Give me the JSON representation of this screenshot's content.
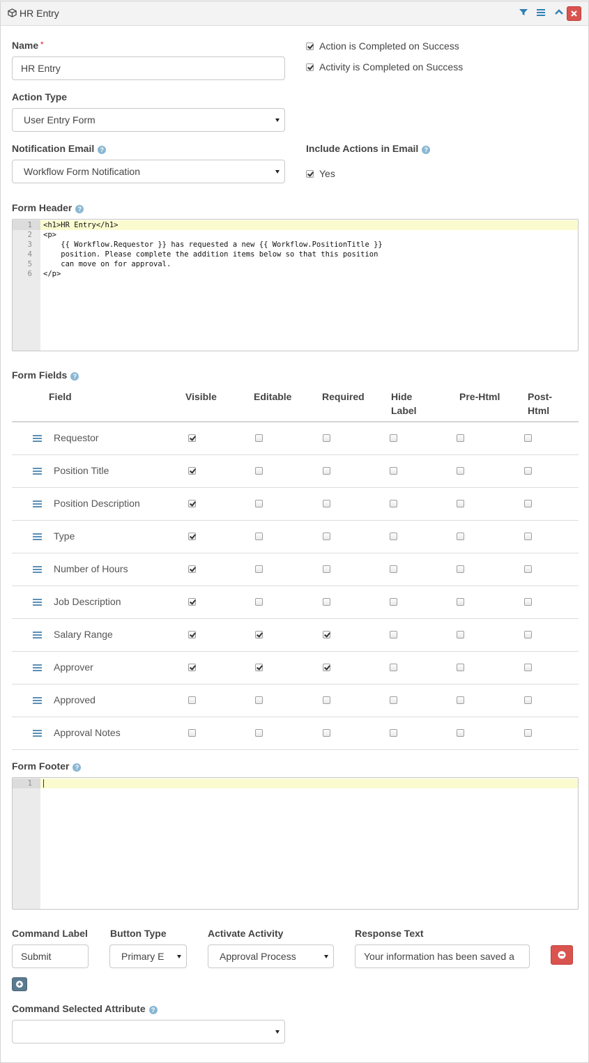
{
  "header": {
    "title": "HR Entry",
    "icons": [
      "cube-icon",
      "filter-icon",
      "menu-icon",
      "chevron-up-icon",
      "close-icon"
    ]
  },
  "name": {
    "label": "Name",
    "value": "HR Entry",
    "required_mark": "*"
  },
  "flags": {
    "action_completed": {
      "label": "Action is Completed on Success",
      "checked": true
    },
    "activity_completed": {
      "label": "Activity is Completed on Success",
      "checked": true
    }
  },
  "action_type": {
    "label": "Action Type",
    "value": "User Entry Form"
  },
  "notification_email": {
    "label": "Notification Email",
    "value": "Workflow Form Notification"
  },
  "include_actions": {
    "label": "Include Actions in Email",
    "option_label": "Yes",
    "checked": true
  },
  "form_header": {
    "label": "Form Header",
    "lines": [
      "<h1>HR Entry</h1>",
      "<p>",
      "    {{ Workflow.Requestor }} has requested a new {{ Workflow.PositionTitle }}",
      "    position. Please complete the addition items below so that this position",
      "    can move on for approval.",
      "</p>"
    ],
    "line_numbers": [
      "1",
      "2",
      "3",
      "4",
      "5",
      "6"
    ]
  },
  "form_fields": {
    "label": "Form Fields",
    "columns": [
      "Field",
      "Visible",
      "Editable",
      "Required",
      "Hide Label",
      "Pre-Html",
      "Post-Html"
    ],
    "column_lines": {
      "hide_label": [
        "Hide",
        "Label"
      ],
      "post_html": [
        "Post-",
        "Html"
      ]
    },
    "rows": [
      {
        "name": "Requestor",
        "visible": true,
        "editable": false,
        "required": false,
        "hide_label": false,
        "pre_html": false,
        "post_html": false
      },
      {
        "name": "Position Title",
        "visible": true,
        "editable": false,
        "required": false,
        "hide_label": false,
        "pre_html": false,
        "post_html": false
      },
      {
        "name": "Position Description",
        "visible": true,
        "editable": false,
        "required": false,
        "hide_label": false,
        "pre_html": false,
        "post_html": false
      },
      {
        "name": "Type",
        "visible": true,
        "editable": false,
        "required": false,
        "hide_label": false,
        "pre_html": false,
        "post_html": false
      },
      {
        "name": "Number of Hours",
        "visible": true,
        "editable": false,
        "required": false,
        "hide_label": false,
        "pre_html": false,
        "post_html": false
      },
      {
        "name": "Job Description",
        "visible": true,
        "editable": false,
        "required": false,
        "hide_label": false,
        "pre_html": false,
        "post_html": false
      },
      {
        "name": "Salary Range",
        "visible": true,
        "editable": true,
        "required": true,
        "hide_label": false,
        "pre_html": false,
        "post_html": false
      },
      {
        "name": "Approver",
        "visible": true,
        "editable": true,
        "required": true,
        "hide_label": false,
        "pre_html": false,
        "post_html": false
      },
      {
        "name": "Approved",
        "visible": false,
        "editable": false,
        "required": false,
        "hide_label": false,
        "pre_html": false,
        "post_html": false
      },
      {
        "name": "Approval Notes",
        "visible": false,
        "editable": false,
        "required": false,
        "hide_label": false,
        "pre_html": false,
        "post_html": false
      }
    ]
  },
  "form_footer": {
    "label": "Form Footer",
    "line_numbers": [
      "1"
    ]
  },
  "commands": {
    "labels": {
      "command_label": "Command Label",
      "button_type": "Button Type",
      "activate_activity": "Activate Activity",
      "response_text": "Response Text"
    },
    "row": {
      "command_label": "Submit",
      "button_type": "Primary E",
      "activate_activity": "Approval Process",
      "response_text": "Your information has been saved a"
    }
  },
  "command_selected_attribute": {
    "label": "Command Selected Attribute",
    "value": ""
  },
  "colors": {
    "accent": "#2f7fb5",
    "danger": "#d9534f",
    "help": "#8ab7d3",
    "active_line": "#fbfbd0"
  }
}
